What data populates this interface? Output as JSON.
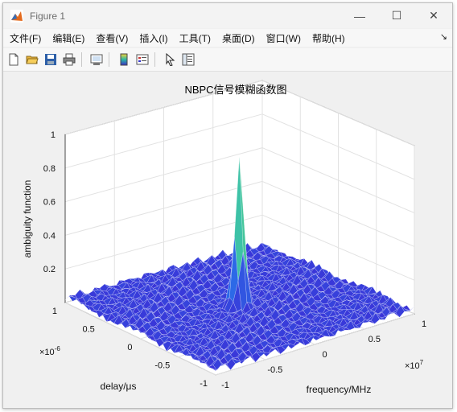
{
  "window": {
    "title": "Figure 1",
    "controls": {
      "minimize": "—",
      "maximize": "☐",
      "close": "✕"
    }
  },
  "menu": {
    "items": [
      "文件(F)",
      "编辑(E)",
      "查看(V)",
      "插入(I)",
      "工具(T)",
      "桌面(D)",
      "窗口(W)",
      "帮助(H)"
    ],
    "overflow_arrow": "↘"
  },
  "toolbar": {
    "icons": [
      "new-figure-icon",
      "open-file-icon",
      "save-icon",
      "print-icon",
      "link-plot-icon",
      "insert-colorbar-icon",
      "insert-legend-icon",
      "pointer-icon",
      "property-inspector-icon"
    ]
  },
  "colors": {
    "accent": "#0072bd",
    "mesh_low": "#3a34d8",
    "peak_top": "#f0d44a"
  },
  "chart_data": {
    "type": "surface",
    "title": "NBPC信号模糊函数图",
    "zlabel": "ambiguity function",
    "ylabel": "delay/μs",
    "xlabel": "frequency/MHz",
    "zlim": [
      0,
      1
    ],
    "z_ticks": [
      "0.2",
      "0.4",
      "0.6",
      "0.8",
      "1"
    ],
    "y_ticks": [
      "1",
      "0.5",
      "0",
      "-0.5",
      "-1"
    ],
    "y_multiplier": "×10",
    "y_exponent": "-6",
    "x_ticks": [
      "-1",
      "-0.5",
      "0",
      "0.5",
      "1"
    ],
    "x_multiplier": "×10",
    "x_exponent": "7",
    "ylim": [
      -1e-06,
      1e-06
    ],
    "xlim": [
      -10000000.0,
      10000000.0
    ],
    "peak": {
      "delay": 0,
      "frequency": 0,
      "value": 0.93
    },
    "floor_level": 0.05,
    "grid": true
  }
}
